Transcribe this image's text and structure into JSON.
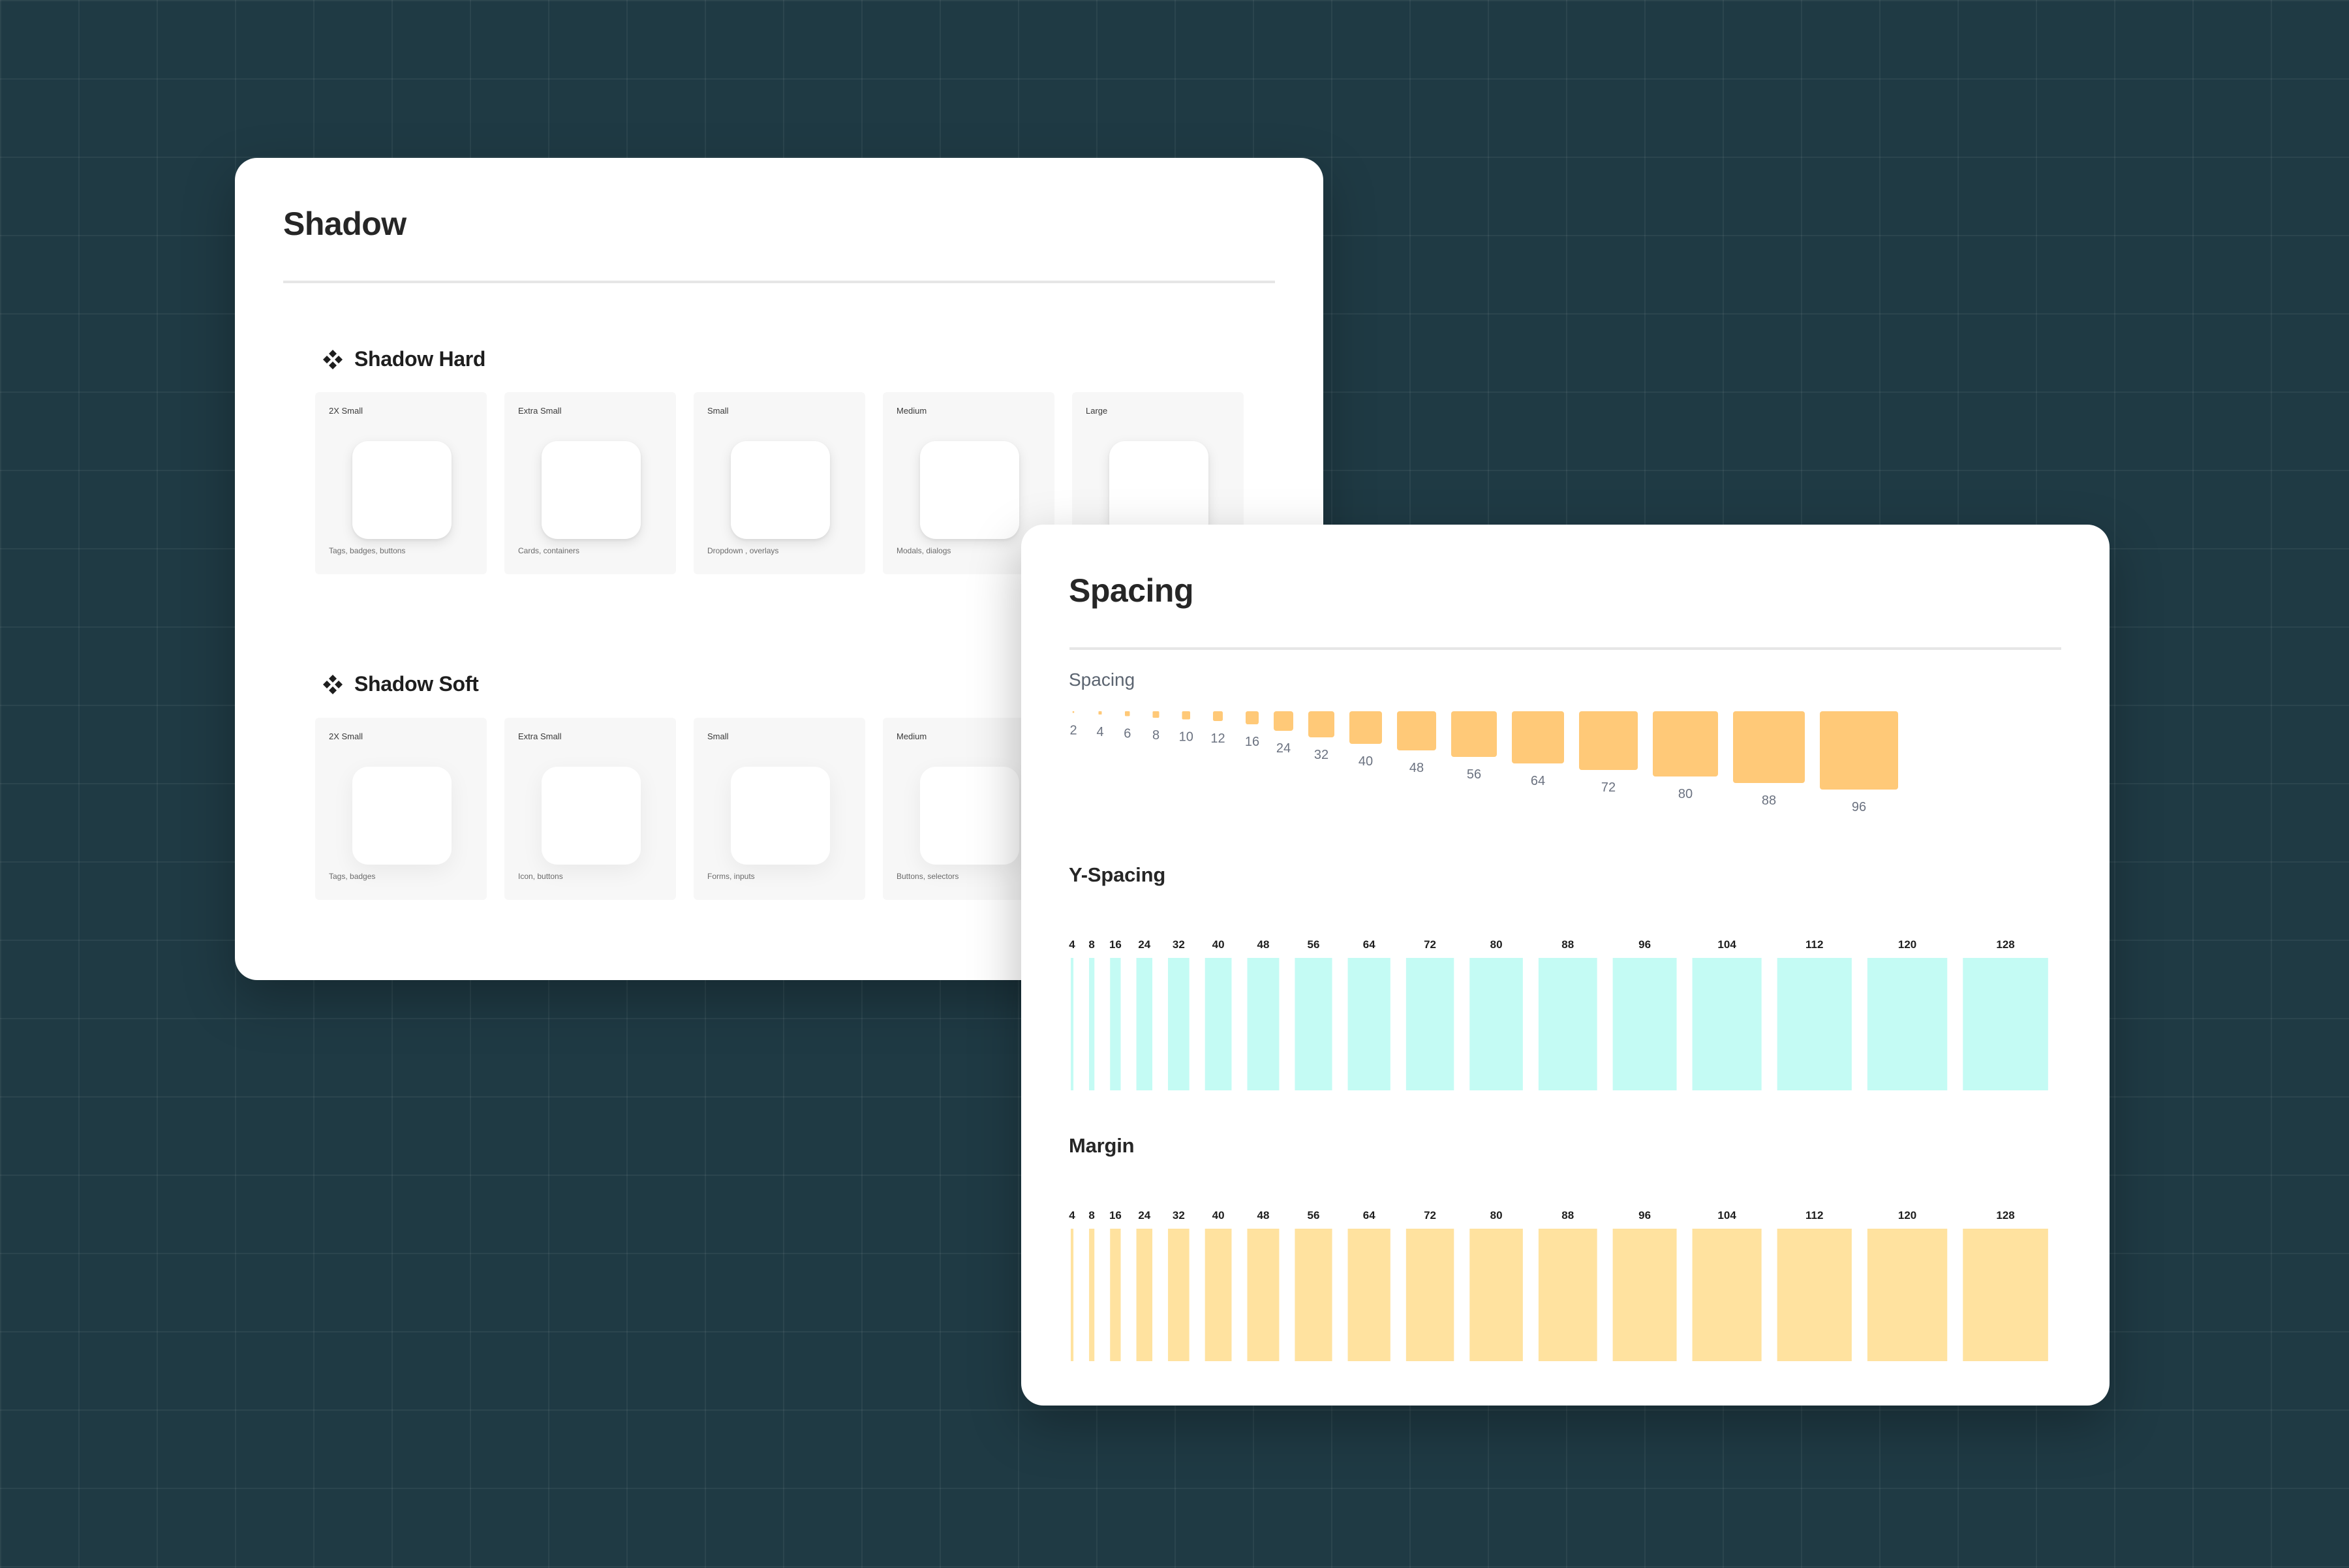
{
  "shadow_card": {
    "title": "Shadow",
    "sections": [
      {
        "label": "Shadow Hard",
        "icon": "component-diamond-icon",
        "tiles": [
          {
            "name": "2X Small",
            "desc": "Tags, badges, buttons"
          },
          {
            "name": "Extra Small",
            "desc": "Cards, containers"
          },
          {
            "name": "Small",
            "desc": "Dropdown , overlays"
          },
          {
            "name": "Medium",
            "desc": "Modals, dialogs"
          },
          {
            "name": "Large",
            "desc": ""
          }
        ]
      },
      {
        "label": "Shadow Soft",
        "icon": "component-diamond-icon",
        "tiles": [
          {
            "name": "2X Small",
            "desc": "Tags, badges"
          },
          {
            "name": "Extra Small",
            "desc": "Icon, buttons"
          },
          {
            "name": "Small",
            "desc": "Forms, inputs"
          },
          {
            "name": "Medium",
            "desc": "Buttons, selectors"
          }
        ]
      }
    ]
  },
  "spacing_card": {
    "title": "Spacing",
    "spacing_label": "Spacing",
    "yspacing_label": "Y-Spacing",
    "margin_label": "Margin",
    "colors": {
      "spacing_square": "#ffc978",
      "yspacing_bar": "#c4fbf4",
      "margin_bar": "#ffe29f",
      "value_text": "#6b7280",
      "bar_label_text": "#1e1e1e"
    }
  },
  "chart_data": [
    {
      "type": "bar",
      "name": "Spacing",
      "categories": [
        "2",
        "4",
        "6",
        "8",
        "10",
        "12",
        "16",
        "24",
        "32",
        "40",
        "48",
        "56",
        "64",
        "72",
        "80",
        "88",
        "96"
      ],
      "values": [
        2,
        4,
        6,
        8,
        10,
        12,
        16,
        24,
        32,
        40,
        48,
        56,
        64,
        72,
        80,
        88,
        96
      ]
    },
    {
      "type": "bar",
      "name": "Y-Spacing",
      "categories": [
        "4",
        "8",
        "16",
        "24",
        "32",
        "40",
        "48",
        "56",
        "64",
        "72",
        "80",
        "88",
        "96",
        "104",
        "112",
        "120",
        "128"
      ],
      "values": [
        4,
        8,
        16,
        24,
        32,
        40,
        48,
        56,
        64,
        72,
        80,
        88,
        96,
        104,
        112,
        120,
        128
      ]
    },
    {
      "type": "bar",
      "name": "Margin",
      "categories": [
        "4",
        "8",
        "16",
        "24",
        "32",
        "40",
        "48",
        "56",
        "64",
        "72",
        "80",
        "88",
        "96",
        "104",
        "112",
        "120",
        "128"
      ],
      "values": [
        4,
        8,
        16,
        24,
        32,
        40,
        48,
        56,
        64,
        72,
        80,
        88,
        96,
        104,
        112,
        120,
        128
      ]
    }
  ]
}
